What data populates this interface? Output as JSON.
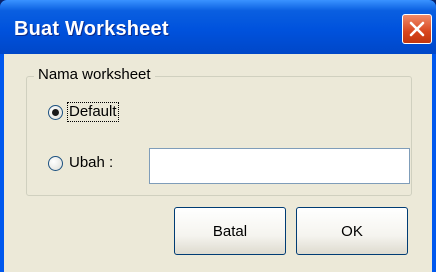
{
  "window": {
    "title": "Buat Worksheet"
  },
  "group": {
    "legend": "Nama worksheet",
    "options": [
      {
        "label": "Default",
        "selected": true
      },
      {
        "label": "Ubah :",
        "selected": false
      }
    ],
    "rename_value": ""
  },
  "buttons": {
    "cancel": "Batal",
    "ok": "OK"
  },
  "colors": {
    "titlebar": "#0052dd",
    "client": "#ece9d8",
    "close_button": "#d8461e"
  }
}
